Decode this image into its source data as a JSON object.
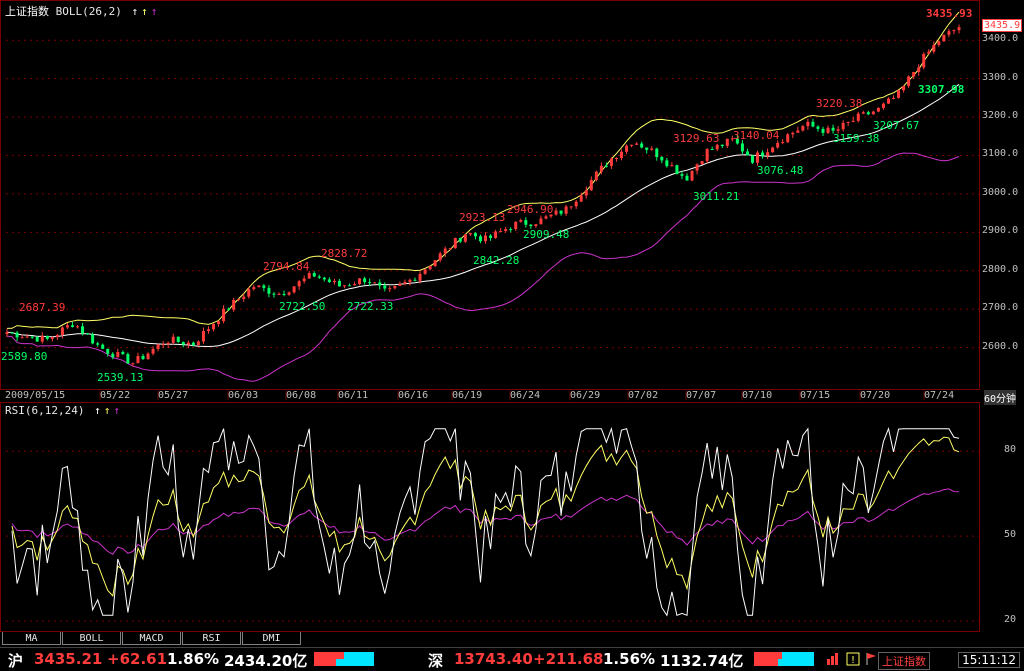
{
  "header": {
    "index_name": "上证指数",
    "indicator": "BOLL(26,2)",
    "rsi_indicator": "RSI(6,12,24)"
  },
  "price_axis": {
    "current_value": "3435.9",
    "ticks": [
      "3400.0",
      "3300.0",
      "3200.0",
      "3100.0",
      "3000.0",
      "2900.0",
      "2800.0",
      "2700.0",
      "2600.0"
    ]
  },
  "rsi_axis": {
    "ticks": [
      "80",
      "50",
      "20"
    ]
  },
  "dates": [
    "2009/05/15",
    "05/22",
    "05/27",
    "06/03",
    "06/08",
    "06/11",
    "06/16",
    "06/19",
    "06/24",
    "06/29",
    "07/02",
    "07/07",
    "07/10",
    "07/15",
    "07/20",
    "07/24"
  ],
  "date_axis_right": "60分钟",
  "annotations": {
    "high": "3435.93",
    "low_right": "3307.98",
    "labels": [
      {
        "text": "2687.39",
        "color": "red"
      },
      {
        "text": "2589.80",
        "color": "green"
      },
      {
        "text": "2539.13",
        "color": "green"
      },
      {
        "text": "2794.84",
        "color": "red"
      },
      {
        "text": "2722.50",
        "color": "green"
      },
      {
        "text": "2828.72",
        "color": "red"
      },
      {
        "text": "2722.33",
        "color": "green"
      },
      {
        "text": "2923.13",
        "color": "red"
      },
      {
        "text": "2842.28",
        "color": "green"
      },
      {
        "text": "2946.90",
        "color": "red"
      },
      {
        "text": "2909.48",
        "color": "green"
      },
      {
        "text": "3129.63",
        "color": "red"
      },
      {
        "text": "3011.21",
        "color": "green"
      },
      {
        "text": "3140.04",
        "color": "red"
      },
      {
        "text": "3076.48",
        "color": "green"
      },
      {
        "text": "3220.38",
        "color": "red"
      },
      {
        "text": "3159.38",
        "color": "green"
      },
      {
        "text": "3207.67",
        "color": "green"
      }
    ]
  },
  "tabs": [
    "MA",
    "BOLL",
    "MACD",
    "RSI",
    "DMI"
  ],
  "status": {
    "sh_label": "沪",
    "sh_price": "3435.21",
    "sh_change": "+62.61",
    "sh_pct": "1.86%",
    "sh_volume": "2434.20亿",
    "sz_label": "深",
    "sz_price": "13743.40",
    "sz_change": "+211.68",
    "sz_pct": "1.56%",
    "sz_volume": "1132.74亿",
    "index_tab": "上证指数",
    "clock": "15:11:12"
  },
  "colors": {
    "up": "#ff3b3b",
    "down": "#00ff66",
    "upper_band": "#ffff66",
    "mid_band": "#ffffff",
    "lower_band": "#cc33cc",
    "rsi6": "#ffffff",
    "rsi12": "#ffff66",
    "rsi24": "#cc33cc",
    "grid": "#7a0000"
  }
}
